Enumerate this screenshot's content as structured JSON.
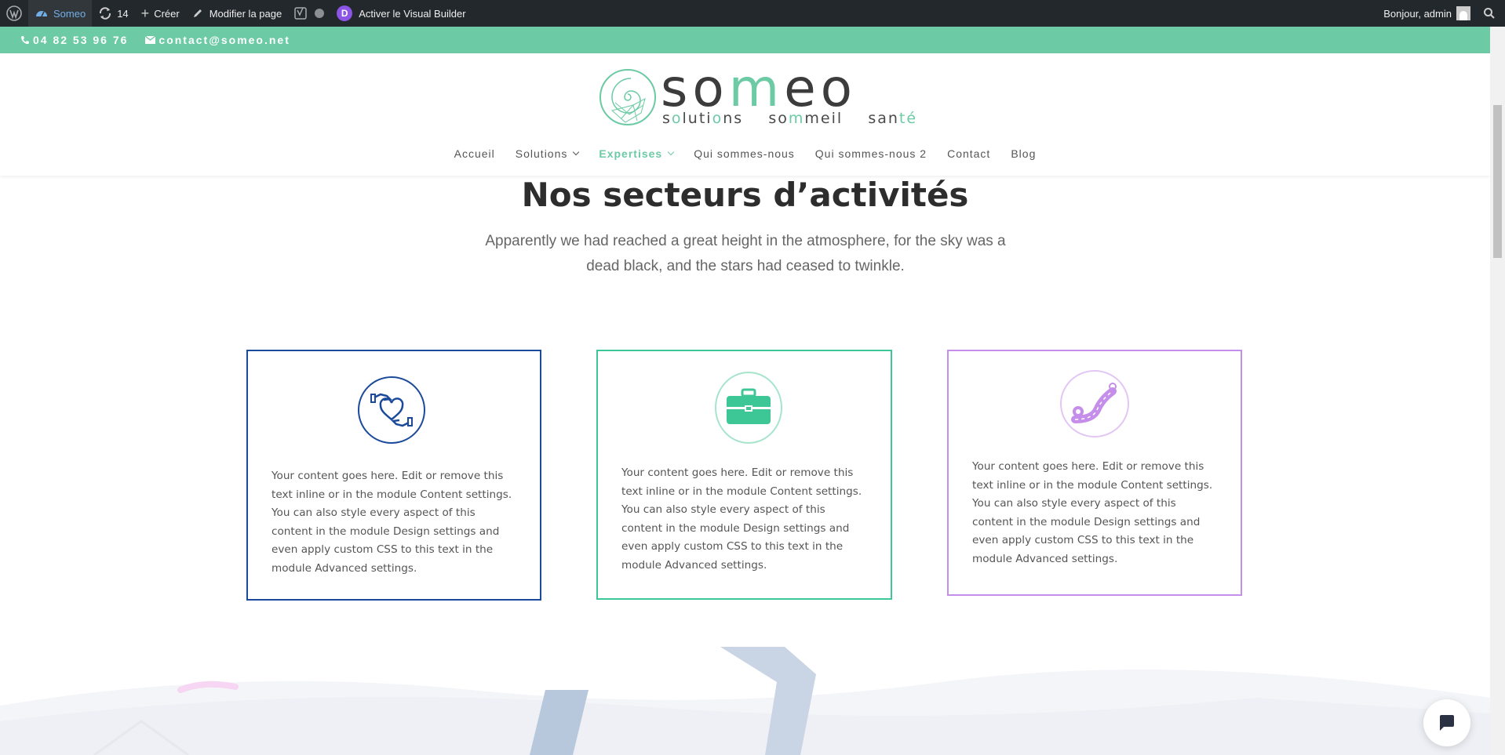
{
  "admin_bar": {
    "site_name": "Someo",
    "updates_count": "14",
    "create_label": "Créer",
    "edit_page_label": "Modifier la page",
    "visual_builder_label": "Activer le Visual Builder",
    "greeting": "Bonjour, admin"
  },
  "topbar": {
    "phone": "04 82 53 96 76",
    "email": "contact@someo.net",
    "color": "#6ccaa4"
  },
  "logo": {
    "word_part1": "so",
    "word_accent": "m",
    "word_part2": "eo",
    "tag_part1": "s",
    "tag_part1b": "o",
    "tag_part1c": "luti",
    "tag_part1d": "o",
    "tag_part1e": "ns",
    "tag_part2a": "so",
    "tag_part2b": "m",
    "tag_part2c": "meil",
    "tag_part3a": "san",
    "tag_part3b": "t",
    "tag_part3c": "é"
  },
  "nav": {
    "items": [
      {
        "label": "Accueil"
      },
      {
        "label": "Solutions"
      },
      {
        "label": "Expertises"
      },
      {
        "label": "Qui sommes-nous"
      },
      {
        "label": "Qui sommes-nous 2"
      },
      {
        "label": "Contact"
      },
      {
        "label": "Blog"
      }
    ]
  },
  "section": {
    "title": "Nos secteurs d’activités",
    "subtitle": "Apparently we had reached a great height in the atmosphere, for the sky was a dead black, and the stars had ceased to twinkle."
  },
  "cards": [
    {
      "icon": "hands-heart-icon",
      "color": "#1c4a9a",
      "text": "Your content goes here. Edit or remove this text inline or in the module Content settings. You can also style every aspect of this content in the module Design settings and even apply custom CSS to this text in the module Advanced settings."
    },
    {
      "icon": "briefcase-icon",
      "color": "#3dc796",
      "text": "Your content goes here. Edit or remove this text inline or in the module Content settings. You can also style every aspect of this content in the module Design settings and even apply custom CSS to this text in the module Advanced settings."
    },
    {
      "icon": "road-pin-icon",
      "color": "#c58eea",
      "text": "Your content goes here. Edit or remove this text inline or in the module Content settings. You can also style every aspect of this content in the module Design settings and even apply custom CSS to this text in the module Advanced settings."
    }
  ]
}
